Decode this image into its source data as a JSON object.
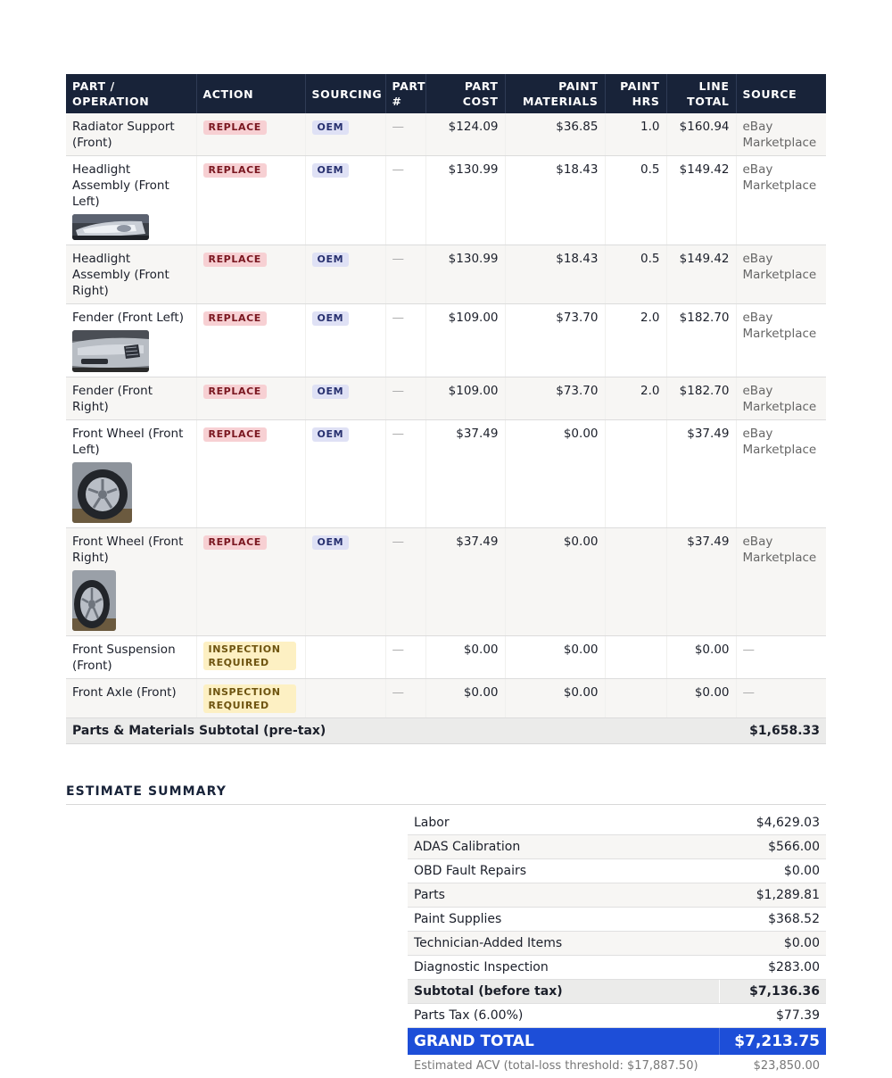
{
  "parts_table": {
    "headers": {
      "part": "PART / OPERATION",
      "action": "ACTION",
      "sourcing": "SOURCING",
      "part_no": "PART #",
      "part_cost": "PART COST",
      "paint_materials": "PAINT MATERIALS",
      "paint_hrs": "PAINT HRS",
      "line_total": "LINE TOTAL",
      "source": "SOURCE"
    },
    "rows": [
      {
        "part": "Radiator Support (Front)",
        "action": "REPLACE",
        "sourcing": "OEM",
        "part_no": "—",
        "part_cost": "$124.09",
        "paint_materials": "$36.85",
        "paint_hrs": "1.0",
        "line_total": "$160.94",
        "source": "eBay Marketplace"
      },
      {
        "part": "Headlight Assembly (Front Left)",
        "action": "REPLACE",
        "sourcing": "OEM",
        "part_no": "—",
        "part_cost": "$130.99",
        "paint_materials": "$18.43",
        "paint_hrs": "0.5",
        "line_total": "$149.42",
        "source": "eBay Marketplace",
        "photo": "headlight-photo"
      },
      {
        "part": "Headlight Assembly (Front Right)",
        "action": "REPLACE",
        "sourcing": "OEM",
        "part_no": "—",
        "part_cost": "$130.99",
        "paint_materials": "$18.43",
        "paint_hrs": "0.5",
        "line_total": "$149.42",
        "source": "eBay Marketplace"
      },
      {
        "part": "Fender (Front Left)",
        "action": "REPLACE",
        "sourcing": "OEM",
        "part_no": "—",
        "part_cost": "$109.00",
        "paint_materials": "$73.70",
        "paint_hrs": "2.0",
        "line_total": "$182.70",
        "source": "eBay Marketplace",
        "photo": "fender-photo"
      },
      {
        "part": "Fender (Front Right)",
        "action": "REPLACE",
        "sourcing": "OEM",
        "part_no": "—",
        "part_cost": "$109.00",
        "paint_materials": "$73.70",
        "paint_hrs": "2.0",
        "line_total": "$182.70",
        "source": "eBay Marketplace"
      },
      {
        "part": "Front Wheel (Front Left)",
        "action": "REPLACE",
        "sourcing": "OEM",
        "part_no": "—",
        "part_cost": "$37.49",
        "paint_materials": "$0.00",
        "paint_hrs": "",
        "line_total": "$37.49",
        "source": "eBay Marketplace",
        "photo": "wheel-photo"
      },
      {
        "part": "Front Wheel (Front Right)",
        "action": "REPLACE",
        "sourcing": "OEM",
        "part_no": "—",
        "part_cost": "$37.49",
        "paint_materials": "$0.00",
        "paint_hrs": "",
        "line_total": "$37.49",
        "source": "eBay Marketplace",
        "photo": "wheel-photo"
      },
      {
        "part": "Front Suspension (Front)",
        "action": "INSPECTION REQUIRED",
        "sourcing": "",
        "part_no": "—",
        "part_cost": "$0.00",
        "paint_materials": "$0.00",
        "paint_hrs": "",
        "line_total": "$0.00",
        "source": "—"
      },
      {
        "part": "Front Axle (Front)",
        "action": "INSPECTION REQUIRED",
        "sourcing": "",
        "part_no": "—",
        "part_cost": "$0.00",
        "paint_materials": "$0.00",
        "paint_hrs": "",
        "line_total": "$0.00",
        "source": "—"
      }
    ],
    "subtotal_label": "Parts & Materials Subtotal (pre-tax)",
    "subtotal_value": "$1,658.33"
  },
  "summary": {
    "title": "ESTIMATE SUMMARY",
    "lines": [
      {
        "label": "Labor",
        "value": "$4,629.03"
      },
      {
        "label": "ADAS Calibration",
        "value": "$566.00"
      },
      {
        "label": "OBD Fault Repairs",
        "value": "$0.00"
      },
      {
        "label": "Parts",
        "value": "$1,289.81"
      },
      {
        "label": "Paint Supplies",
        "value": "$368.52"
      },
      {
        "label": "Technician-Added Items",
        "value": "$0.00"
      },
      {
        "label": "Diagnostic Inspection",
        "value": "$283.00"
      }
    ],
    "subtotal": {
      "label": "Subtotal (before tax)",
      "value": "$7,136.36"
    },
    "tax": {
      "label": "Parts Tax (6.00%)",
      "value": "$77.39"
    },
    "grand_total": {
      "label": "GRAND TOTAL",
      "value": "$7,213.75"
    },
    "acv": {
      "label": "Estimated ACV (total-loss threshold: $17,887.50)",
      "value": "$23,850.00"
    }
  },
  "colors": {
    "header_bg": "#182339",
    "grand_total_bg": "#1d4ed8",
    "replace_badge": "#f7d0d3",
    "oem_badge": "#dfe1f5",
    "inspection_badge": "#fdf0c3"
  }
}
